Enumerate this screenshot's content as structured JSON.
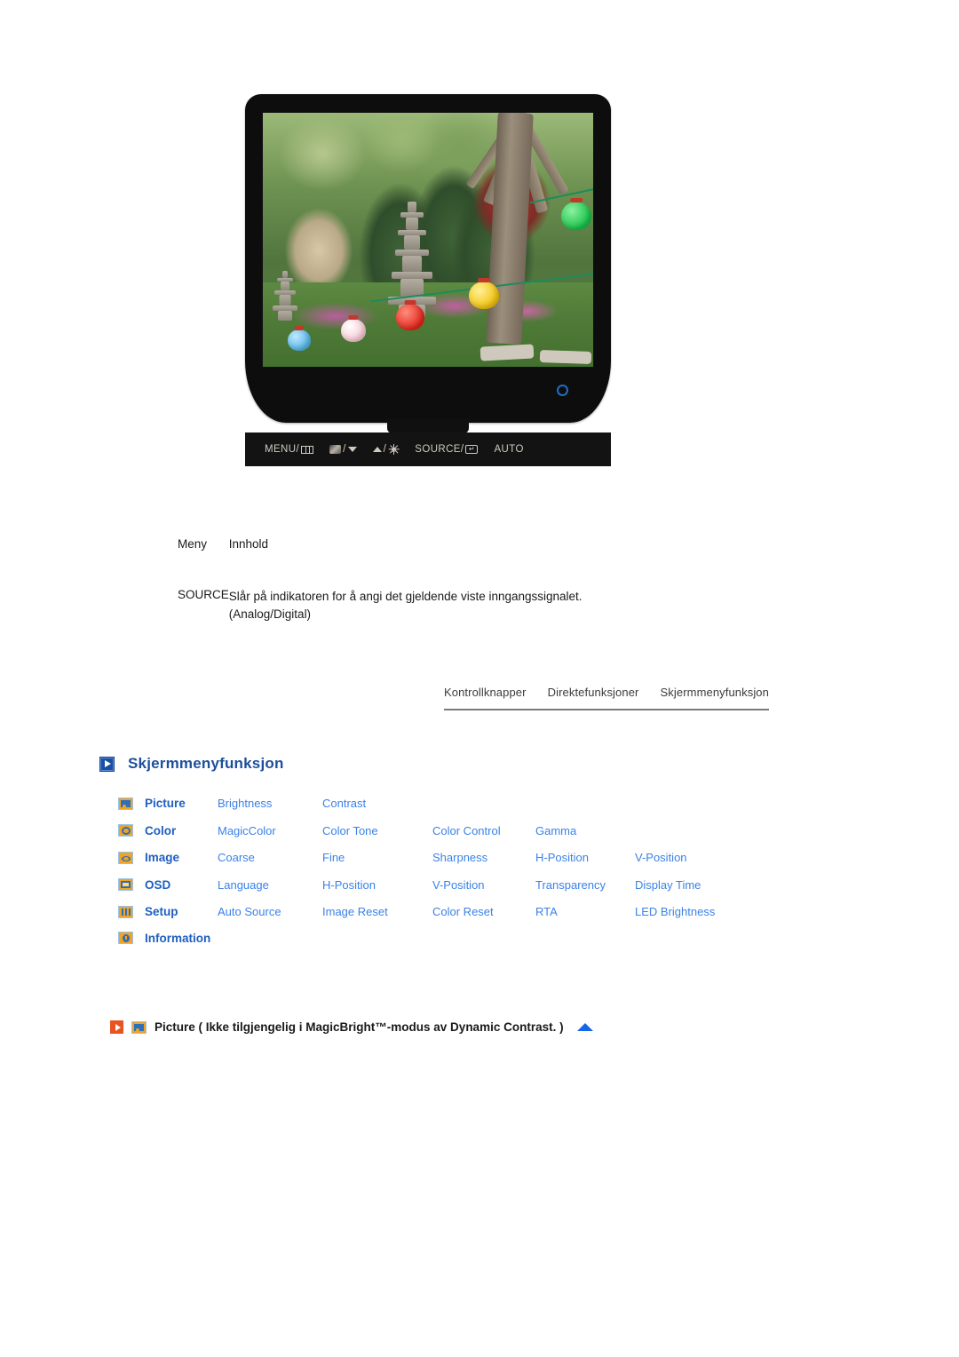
{
  "monitor": {
    "alt": "samsung-lcd-monitor-front-view",
    "power_led": "power-indicator",
    "control_buttons": [
      {
        "label": "MENU/",
        "icon": "menu-grid-icon"
      },
      {
        "label": "/",
        "icon": "magicbright-icon",
        "icon2": "arrow-down-icon"
      },
      {
        "label": "/",
        "icon": "arrow-up-icon",
        "icon2": "brightness-sun-icon"
      },
      {
        "label": "SOURCE/",
        "icon": "enter-key-icon"
      },
      {
        "label": "AUTO",
        "icon": ""
      }
    ]
  },
  "table": {
    "headers": {
      "menu": "Meny",
      "content": "Innhold"
    },
    "rows": [
      {
        "menu": "SOURCE",
        "content_line1": "Slår på indikatoren for å angi det gjeldende viste inngangssignalet.",
        "content_line2": "(Analog/Digital)"
      }
    ]
  },
  "tabs": [
    {
      "label": "Kontrollknapper"
    },
    {
      "label": "Direktefunksjoner"
    },
    {
      "label": "Skjermmenyfunksjon"
    }
  ],
  "heading": {
    "icon": "blue-play-square-icon",
    "text": "Skjermmenyfunksjon"
  },
  "osd_menu": {
    "rows": [
      {
        "icon": "picture-icon",
        "category": "Picture",
        "items": [
          "Brightness",
          "Contrast",
          "",
          "",
          ""
        ]
      },
      {
        "icon": "color-icon",
        "category": "Color",
        "items": [
          "MagicColor",
          "Color Tone",
          "Color Control",
          "Gamma",
          ""
        ]
      },
      {
        "icon": "image-icon",
        "category": "Image",
        "items": [
          "Coarse",
          "Fine",
          "Sharpness",
          "H-Position",
          "V-Position"
        ]
      },
      {
        "icon": "osd-icon",
        "category": "OSD",
        "items": [
          "Language",
          "H-Position",
          "V-Position",
          "Transparency",
          "Display Time"
        ]
      },
      {
        "icon": "setup-icon",
        "category": "Setup",
        "items": [
          "Auto Source",
          "Image Reset",
          "Color Reset",
          "RTA",
          "LED Brightness"
        ]
      },
      {
        "icon": "information-icon",
        "category": "Information",
        "items": [
          "",
          "",
          "",
          "",
          ""
        ]
      }
    ]
  },
  "caption": {
    "play_icon": "orange-play-icon",
    "menu_icon": "picture-icon",
    "text": "Picture ( Ikke tilgjengelig i MagicBright™-modus av Dynamic Contrast. )",
    "top_icon": "scroll-to-top-icon"
  },
  "colors": {
    "heading_blue": "#1c4f9c",
    "link_blue": "#3b82e8",
    "category_blue": "#1f5fc0",
    "icon_orange": "#f0a325",
    "accent_orange": "#e8531f",
    "top_arrow_blue": "#1667e8"
  }
}
